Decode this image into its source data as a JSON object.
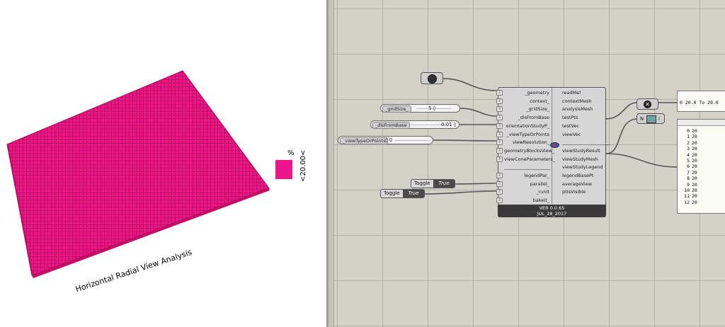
{
  "viewport": {
    "title": "Horizontal Radial View Analysis",
    "legend": {
      "unit": "%",
      "value": "<20.00<",
      "color": "#f0148a"
    }
  },
  "canvas": {
    "sliders": [
      {
        "label": "_gridSize_",
        "value": "5 ◊"
      },
      {
        "label": "_disFromBase",
        "value": "0.01 ◊"
      },
      {
        "label": "_viewTypeOrPoints",
        "value": "◊ 0"
      }
    ],
    "toggles": [
      {
        "label": "Toggle",
        "value": "True"
      },
      {
        "label": "Toggle",
        "value": "True"
      }
    ],
    "component": {
      "inputs": [
        "_geometry",
        "context_",
        "_gridSize_",
        "_disFromBase",
        "orientationStudyP_",
        "_viewTypeOrPoints",
        "viewResolution_",
        "geometryBlocksView_",
        "viewConeParameters_",
        "____________________",
        "legendPar_",
        "parallel_",
        "_runIt",
        "bakeIt_"
      ],
      "outputs": [
        "readMe!",
        "contextMesh",
        "analysisMesh",
        "testPts",
        "testVec",
        "viewVec",
        "_____________________",
        "viewStudyResult",
        "viewStudyMesh",
        "viewStudyLegend",
        "legendBasePt",
        "averageView",
        "ptIsVisible"
      ],
      "version": "VER 0.0.65",
      "date": "JUL_28_2017"
    },
    "panel_top": {
      "text": "0 20.0 To 20.0"
    },
    "panel_list": {
      "rows": [
        {
          "i": "0",
          "v": "20"
        },
        {
          "i": "1",
          "v": "20"
        },
        {
          "i": "2",
          "v": "20"
        },
        {
          "i": "3",
          "v": "20"
        },
        {
          "i": "4",
          "v": "20"
        },
        {
          "i": "5",
          "v": "20"
        },
        {
          "i": "6",
          "v": "20"
        },
        {
          "i": "7",
          "v": "20"
        },
        {
          "i": "8",
          "v": "20"
        },
        {
          "i": "9",
          "v": "20"
        },
        {
          "i": "10",
          "v": "20"
        },
        {
          "i": "11",
          "v": "20"
        },
        {
          "i": "12",
          "v": "20"
        }
      ]
    },
    "colors": {
      "grid_bg": "#d4d2c8",
      "mesh": "#f0148a"
    }
  }
}
